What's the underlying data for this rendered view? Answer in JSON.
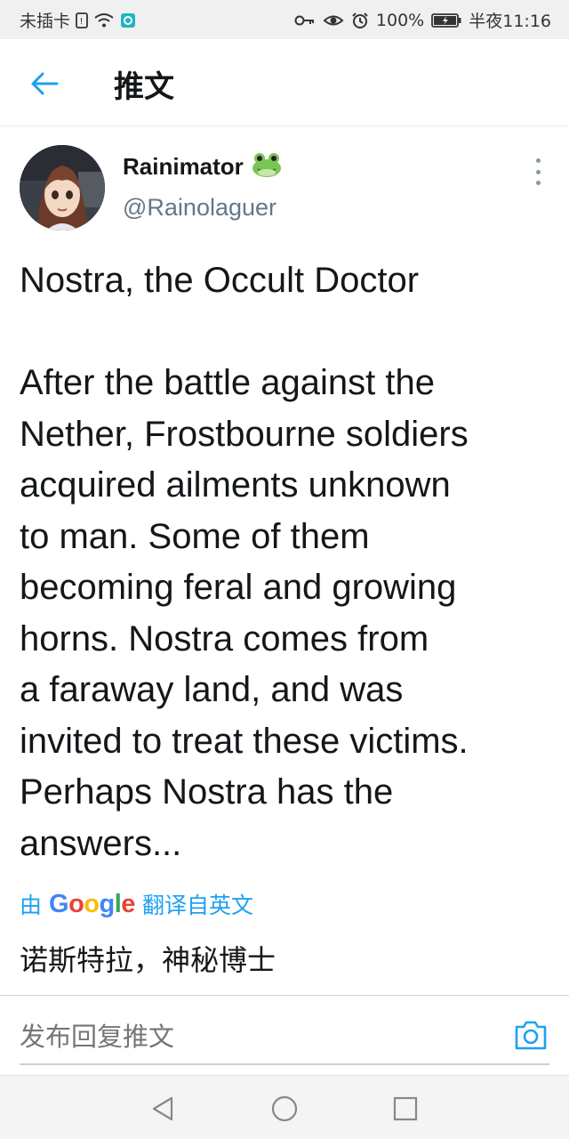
{
  "status_bar": {
    "carrier": "未插卡",
    "battery": "100%",
    "time": "半夜11:16"
  },
  "header": {
    "title": "推文"
  },
  "tweet": {
    "author": {
      "display_name": "Rainimator",
      "handle": "@Rainolaguer",
      "badge_emoji": "frog-emoji"
    },
    "text": "Nostra, the Occult Doctor\n\nAfter the battle against the\nNether, Frostbourne soldiers\nacquired ailments unknown\nto man. Some of them\nbecoming feral and growing\nhorns. Nostra comes from\na faraway land, and was\ninvited to treat these victims.\nPerhaps Nostra has the\nanswers...",
    "translation": {
      "prefix": "由",
      "provider": "Google",
      "suffix": "翻译自英文",
      "text": "诺斯特拉，神秘博士"
    }
  },
  "reply": {
    "placeholder": "发布回复推文"
  },
  "colors": {
    "accent": "#1da1f2",
    "text_primary": "#14171a",
    "text_secondary": "#657786"
  }
}
